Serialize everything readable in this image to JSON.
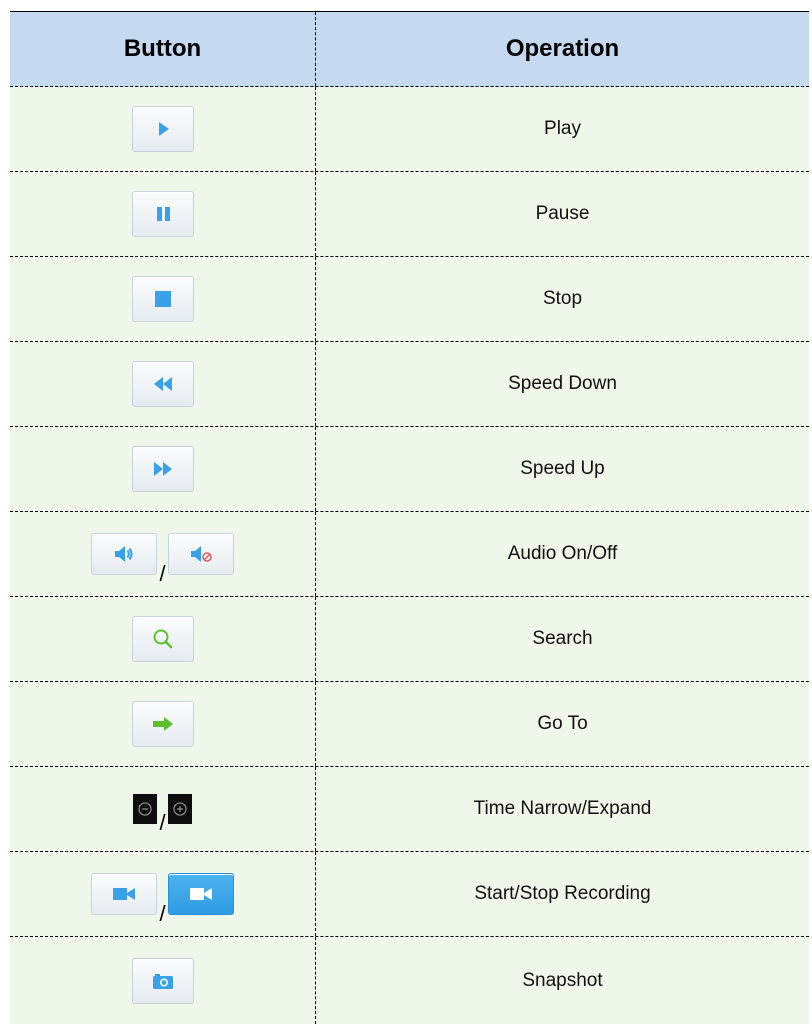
{
  "table": {
    "header": {
      "button_label": "Button",
      "operation_label": "Operation"
    },
    "separator": "/",
    "rows": [
      {
        "operation": "Play",
        "icons": [
          "play-icon"
        ]
      },
      {
        "operation": "Pause",
        "icons": [
          "pause-icon"
        ]
      },
      {
        "operation": "Stop",
        "icons": [
          "stop-icon"
        ]
      },
      {
        "operation": "Speed Down",
        "icons": [
          "rewind-icon"
        ]
      },
      {
        "operation": "Speed Up",
        "icons": [
          "fast-forward-icon"
        ]
      },
      {
        "operation": "Audio On/Off",
        "icons": [
          "audio-on-icon",
          "audio-off-icon"
        ]
      },
      {
        "operation": "Search",
        "icons": [
          "search-icon"
        ]
      },
      {
        "operation": "Go To",
        "icons": [
          "arrow-right-icon"
        ]
      },
      {
        "operation": "Time Narrow/Expand",
        "icons": [
          "zoom-out-icon",
          "zoom-in-icon"
        ]
      },
      {
        "operation": "Start/Stop Recording",
        "icons": [
          "video-camera-icon",
          "video-camera-active-icon"
        ]
      },
      {
        "operation": "Snapshot",
        "icons": [
          "camera-icon"
        ]
      }
    ]
  },
  "colors": {
    "header_bg": "#c5d9f1",
    "row_bg": "#eff6ea",
    "icon_blue": "#3aa1e8",
    "icon_green": "#5cc02e"
  }
}
